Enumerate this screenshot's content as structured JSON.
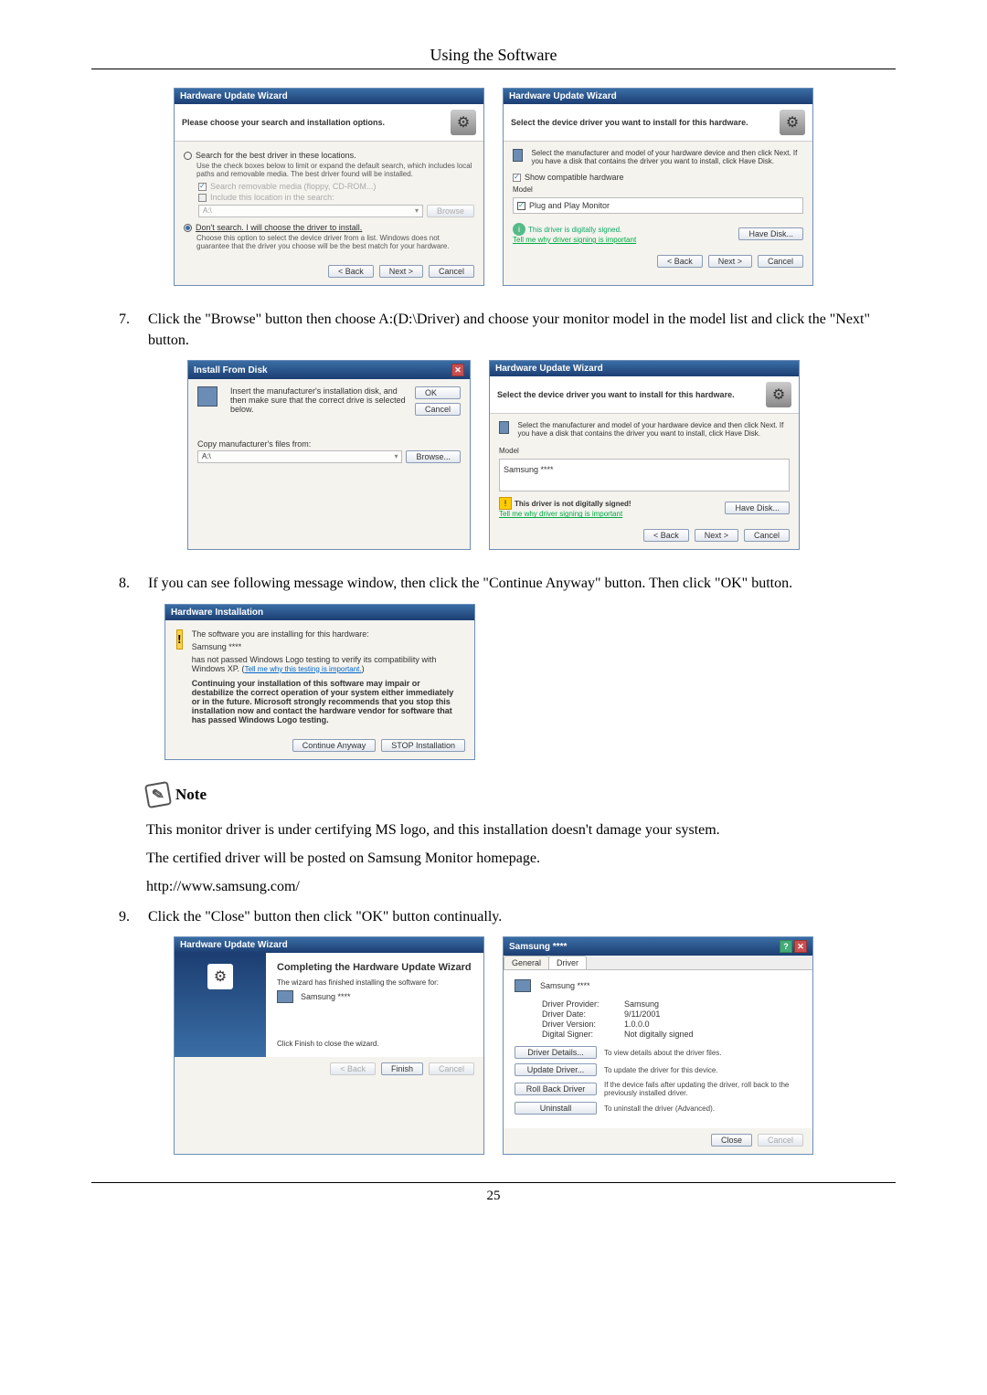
{
  "header": {
    "title": "Using the Software"
  },
  "dlg1": {
    "title": "Hardware Update Wizard",
    "header": "Please choose your search and installation options.",
    "opt1": "Search for the best driver in these locations.",
    "opt1_desc": "Use the check boxes below to limit or expand the default search, which includes local paths and removable media. The best driver found will be installed.",
    "chk1": "Search removable media (floppy, CD-ROM...)",
    "chk2": "Include this location in the search:",
    "path": "A:\\",
    "browse": "Browse",
    "opt2": "Don't search. I will choose the driver to install.",
    "opt2_desc": "Choose this option to select the device driver from a list. Windows does not guarantee that the driver you choose will be the best match for your hardware.",
    "back": "< Back",
    "next": "Next >",
    "cancel": "Cancel"
  },
  "dlg2": {
    "title": "Hardware Update Wizard",
    "header": "Select the device driver you want to install for this hardware.",
    "desc": "Select the manufacturer and model of your hardware device and then click Next. If you have a disk that contains the driver you want to install, click Have Disk.",
    "show_compat": "Show compatible hardware",
    "model_label": "Model",
    "model_item": "Plug and Play Monitor",
    "signed": "This driver is digitally signed.",
    "tell": "Tell me why driver signing is important",
    "have_disk": "Have Disk...",
    "back": "< Back",
    "next": "Next >",
    "cancel": "Cancel"
  },
  "step7": {
    "num": "7.",
    "text": "Click the \"Browse\" button then choose A:(D:\\Driver) and choose your monitor model in the model list and click the \"Next\" button."
  },
  "dlg3": {
    "title": "Install From Disk",
    "desc": "Insert the manufacturer's installation disk, and then make sure that the correct drive is selected below.",
    "ok": "OK",
    "cancel": "Cancel",
    "copy_label": "Copy manufacturer's files from:",
    "path": "A:\\",
    "browse": "Browse..."
  },
  "dlg4": {
    "title": "Hardware Update Wizard",
    "header": "Select the device driver you want to install for this hardware.",
    "desc": "Select the manufacturer and model of your hardware device and then click Next. If you have a disk that contains the driver you want to install, click Have Disk.",
    "model_label": "Model",
    "model_item": "Samsung ****",
    "not_signed": "This driver is not digitally signed!",
    "tell": "Tell me why driver signing is important",
    "have_disk": "Have Disk...",
    "back": "< Back",
    "next": "Next >",
    "cancel": "Cancel"
  },
  "step8": {
    "num": "8.",
    "text": "If you can see following message window, then click the \"Continue Anyway\" button. Then click \"OK\" button."
  },
  "dlg5": {
    "title": "Hardware Installation",
    "line1": "The software you are installing for this hardware:",
    "line2": "Samsung ****",
    "line3a": "has not passed Windows Logo testing to verify its compatibility with Windows XP. (",
    "line3_link": "Tell me why this testing is important.",
    "line3b": ")",
    "bold": "Continuing your installation of this software may impair or destabilize the correct operation of your system either immediately or in the future. Microsoft strongly recommends that you stop this installation now and contact the hardware vendor for software that has passed Windows Logo testing.",
    "continue": "Continue Anyway",
    "stop": "STOP Installation"
  },
  "note": {
    "label": "Note"
  },
  "para1": "This monitor driver is under certifying MS logo, and this installation doesn't damage your system.",
  "para2": "The certified driver will be posted on Samsung Monitor homepage.",
  "para3": "http://www.samsung.com/",
  "step9": {
    "num": "9.",
    "text": "Click the \"Close\" button then click \"OK\" button continually."
  },
  "dlg6": {
    "title": "Hardware Update Wizard",
    "heading": "Completing the Hardware Update Wizard",
    "desc": "The wizard has finished installing the software for:",
    "device": "Samsung ****",
    "finish_hint": "Click Finish to close the wizard.",
    "back": "< Back",
    "finish": "Finish",
    "cancel": "Cancel"
  },
  "dlg7": {
    "title": "Samsung ****",
    "tab_general": "General",
    "tab_driver": "Driver",
    "device": "Samsung ****",
    "provider_l": "Driver Provider:",
    "provider_v": "Samsung",
    "date_l": "Driver Date:",
    "date_v": "9/11/2001",
    "version_l": "Driver Version:",
    "version_v": "1.0.0.0",
    "signer_l": "Digital Signer:",
    "signer_v": "Not digitally signed",
    "b1": "Driver Details...",
    "d1": "To view details about the driver files.",
    "b2": "Update Driver...",
    "d2": "To update the driver for this device.",
    "b3": "Roll Back Driver",
    "d3": "If the device fails after updating the driver, roll back to the previously installed driver.",
    "b4": "Uninstall",
    "d4": "To uninstall the driver (Advanced).",
    "close": "Close",
    "cancel": "Cancel"
  },
  "footer": {
    "page": "25"
  }
}
